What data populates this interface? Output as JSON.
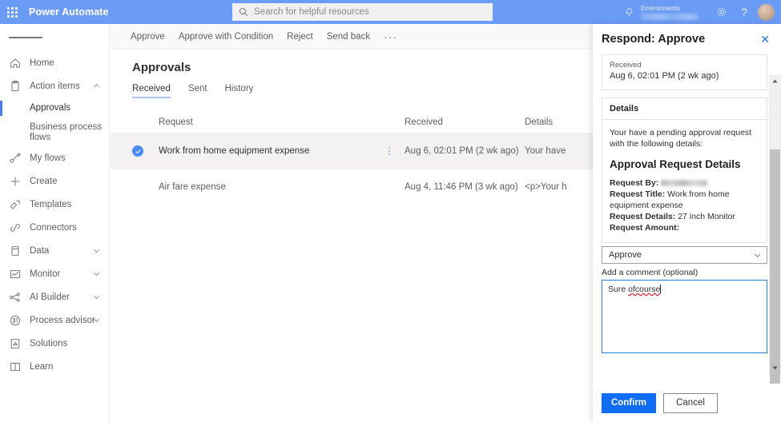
{
  "header": {
    "waffle_label": "app-launcher",
    "brand": "Power Automate",
    "search_placeholder": "Search for helpful resources",
    "search_value": "",
    "environments_label": "Environments",
    "environment_name": "",
    "notifications_icon": "bell-icon",
    "settings_icon": "gear-icon",
    "help_icon": "question-mark-icon",
    "avatar_icon": "user-avatar"
  },
  "sidebar": {
    "items": [
      {
        "label": "Home",
        "icon": "home-icon",
        "expandable": false,
        "selected": false
      },
      {
        "label": "Action items",
        "icon": "clipboard-icon",
        "expandable": true,
        "selected": false
      },
      {
        "label": "Approvals",
        "icon": "",
        "expandable": false,
        "selected": true,
        "sub": true
      },
      {
        "label": "Business process flows",
        "icon": "",
        "expandable": false,
        "selected": false,
        "sub": true
      },
      {
        "label": "My flows",
        "icon": "flow-icon",
        "expandable": false,
        "selected": false
      },
      {
        "label": "Create",
        "icon": "plus-icon",
        "expandable": false,
        "selected": false
      },
      {
        "label": "Templates",
        "icon": "templates-icon",
        "expandable": false,
        "selected": false
      },
      {
        "label": "Connectors",
        "icon": "connectors-icon",
        "expandable": false,
        "selected": false
      },
      {
        "label": "Data",
        "icon": "database-icon",
        "expandable": true,
        "selected": false
      },
      {
        "label": "Monitor",
        "icon": "monitor-icon",
        "expandable": true,
        "selected": false
      },
      {
        "label": "AI Builder",
        "icon": "ai-builder-icon",
        "expandable": true,
        "selected": false
      },
      {
        "label": "Process advisor",
        "icon": "process-advisor-icon",
        "expandable": true,
        "selected": false
      },
      {
        "label": "Solutions",
        "icon": "solutions-icon",
        "expandable": false,
        "selected": false
      },
      {
        "label": "Learn",
        "icon": "book-icon",
        "expandable": false,
        "selected": false
      }
    ]
  },
  "commandbar": {
    "approve": "Approve",
    "approve_with_condition": "Approve with Condition",
    "reject": "Reject",
    "send_back": "Send back",
    "overflow": "···"
  },
  "main": {
    "page_title": "Approvals",
    "tabs": [
      {
        "label": "Received",
        "active": true
      },
      {
        "label": "Sent",
        "active": false
      },
      {
        "label": "History",
        "active": false
      }
    ],
    "table": {
      "columns": [
        "Request",
        "Received",
        "Details"
      ],
      "rows": [
        {
          "request": "Work from home equipment expense",
          "received": "Aug 6, 02:01 PM (2 wk ago)",
          "details": "Your have",
          "selected": true,
          "menu_icon": "more-vertical-icon",
          "check_icon": "check-circle-icon"
        },
        {
          "request": "Air fare expense",
          "received": "Aug 4, 11:46 PM (3 wk ago)",
          "details": "<p>Your h",
          "selected": false,
          "menu_icon": "more-vertical-icon",
          "check_icon": ""
        }
      ]
    }
  },
  "panel": {
    "title": "Respond: Approve",
    "close_icon": "close-icon",
    "received": {
      "label": "Received",
      "value": "Aug 6, 02:01 PM (2 wk ago)"
    },
    "details_card": {
      "header": "Details",
      "intro": "Your have a pending approval request with the following details:",
      "heading": "Approval Request Details",
      "fields": [
        {
          "key": "Request By:",
          "value": "",
          "redacted": true
        },
        {
          "key": "Request Title:",
          "value": "Work from home equipment expense",
          "redacted": false
        },
        {
          "key": "Request Details:",
          "value": "27 inch Monitor",
          "redacted": false
        },
        {
          "key": "Request Amount:",
          "value": "",
          "redacted": false
        }
      ]
    },
    "response_select": {
      "value": "Approve",
      "chevron_icon": "chevron-down-icon"
    },
    "comment": {
      "label": "Add a comment (optional)",
      "value_part1": "Sure ",
      "value_misspelled": "ofcourse",
      "placeholder": ""
    },
    "footer": {
      "confirm": "Confirm",
      "cancel": "Cancel"
    },
    "scrollbar": {
      "up_icon": "scroll-up-icon",
      "down_icon": "scroll-down-icon"
    }
  },
  "colors": {
    "header_blue": "#6b9cf5",
    "accent_blue": "#0f6cf5",
    "focus_blue": "#2b7cd3",
    "check_blue": "#4b8df8",
    "selected_row": "#f3f2f1",
    "cmdbar_bg": "#faf9f8",
    "text_primary": "#323130",
    "text_secondary": "#605e5c",
    "spellcheck_red": "#e81123"
  }
}
